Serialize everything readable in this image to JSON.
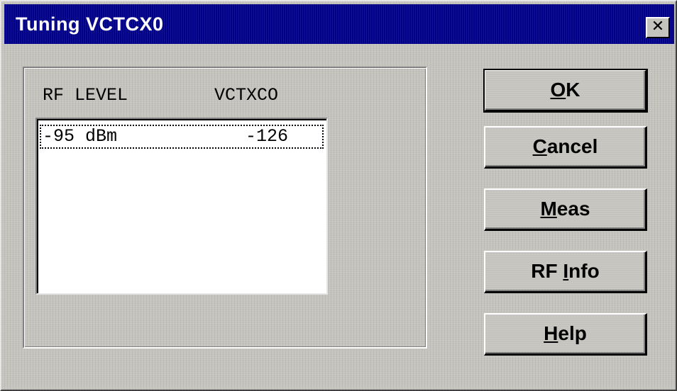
{
  "window": {
    "title": "Tuning VCTCX0",
    "close_glyph": "✕"
  },
  "group": {
    "header_rf_level": "RF LEVEL",
    "header_vctxco": "VCTXCO"
  },
  "list": {
    "rows": [
      {
        "rf_level": "-95 dBm",
        "vctxco": "-126"
      }
    ]
  },
  "buttons": {
    "ok": {
      "accel": "O",
      "rest": "K"
    },
    "cancel": {
      "accel": "C",
      "rest": "ancel"
    },
    "meas": {
      "accel": "M",
      "rest": "eas"
    },
    "rf_info": {
      "pre": "RF ",
      "accel": "I",
      "rest": "nfo"
    },
    "help": {
      "accel": "H",
      "rest": "elp"
    }
  },
  "colors": {
    "titlebar": "#000088",
    "face": "#c4c3bd"
  }
}
